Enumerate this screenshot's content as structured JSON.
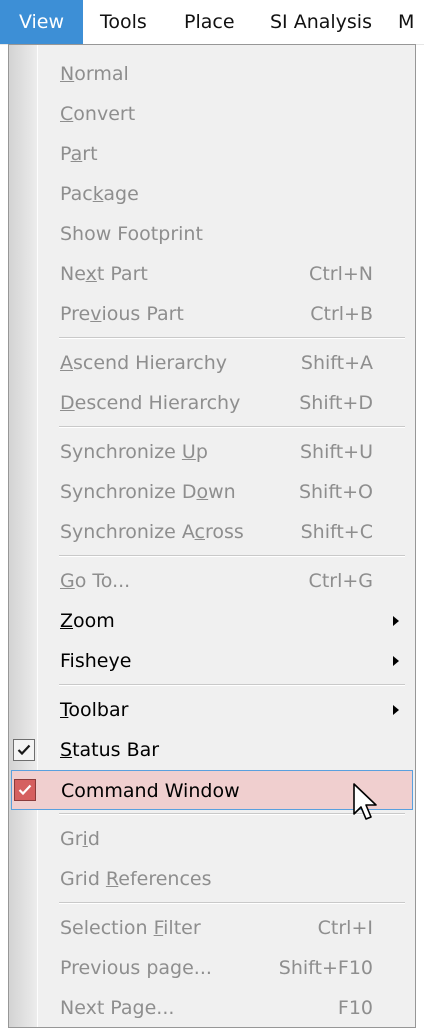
{
  "menubar": {
    "items": [
      {
        "label": "View",
        "active": true
      },
      {
        "label": "Tools"
      },
      {
        "label": "Place"
      },
      {
        "label": "SI Analysis"
      },
      {
        "label": "M"
      }
    ]
  },
  "menu": {
    "items": [
      {
        "pre": "",
        "u": "N",
        "post": "ormal",
        "shortcut": "",
        "state": "disabled"
      },
      {
        "pre": "",
        "u": "C",
        "post": "onvert",
        "shortcut": "",
        "state": "disabled"
      },
      {
        "pre": "P",
        "u": "a",
        "post": "rt",
        "shortcut": "",
        "state": "disabled"
      },
      {
        "pre": "Pac",
        "u": "k",
        "post": "age",
        "shortcut": "",
        "state": "disabled"
      },
      {
        "pre": "Show Footprint",
        "u": "",
        "post": "",
        "shortcut": "",
        "state": "disabled"
      },
      {
        "pre": "Ne",
        "u": "x",
        "post": "t Part",
        "shortcut": "Ctrl+N",
        "state": "disabled"
      },
      {
        "pre": "Pre",
        "u": "v",
        "post": "ious Part",
        "shortcut": "Ctrl+B",
        "state": "disabled"
      },
      {
        "pre": "",
        "u": "A",
        "post": "scend Hierarchy",
        "shortcut": "Shift+A",
        "state": "disabled"
      },
      {
        "pre": "",
        "u": "D",
        "post": "escend Hierarchy",
        "shortcut": "Shift+D",
        "state": "disabled"
      },
      {
        "pre": "Synchronize ",
        "u": "U",
        "post": "p",
        "shortcut": "Shift+U",
        "state": "disabled"
      },
      {
        "pre": "Synchronize D",
        "u": "o",
        "post": "wn",
        "shortcut": "Shift+O",
        "state": "disabled"
      },
      {
        "pre": "Synchronize A",
        "u": "c",
        "post": "ross",
        "shortcut": "Shift+C",
        "state": "disabled"
      },
      {
        "pre": "",
        "u": "G",
        "post": "o To...",
        "shortcut": "Ctrl+G",
        "state": "disabled"
      },
      {
        "pre": "",
        "u": "Z",
        "post": "oom",
        "shortcut": "",
        "state": "enabled",
        "submenu": true
      },
      {
        "pre": "Fisheye",
        "u": "",
        "post": "",
        "shortcut": "",
        "state": "enabled",
        "submenu": true
      },
      {
        "pre": "",
        "u": "T",
        "post": "oolbar",
        "shortcut": "",
        "state": "enabled",
        "submenu": true
      },
      {
        "pre": "",
        "u": "S",
        "post": "tatus Bar",
        "shortcut": "",
        "state": "enabled",
        "checked": true
      },
      {
        "pre": "Command Window",
        "u": "",
        "post": "",
        "shortcut": "",
        "state": "enabled",
        "checked": true,
        "highlighted": true
      },
      {
        "pre": "Gr",
        "u": "i",
        "post": "d",
        "shortcut": "",
        "state": "disabled"
      },
      {
        "pre": "Grid ",
        "u": "R",
        "post": "eferences",
        "shortcut": "",
        "state": "disabled"
      },
      {
        "pre": "Selection ",
        "u": "F",
        "post": "ilter",
        "shortcut": "Ctrl+I",
        "state": "disabled"
      },
      {
        "pre": "Previous page...",
        "u": "",
        "post": "",
        "shortcut": "Shift+F10",
        "state": "disabled"
      },
      {
        "pre": "Next Page...",
        "u": "",
        "post": "",
        "shortcut": "F10",
        "state": "disabled"
      }
    ]
  },
  "colors": {
    "menubar_active": "#3d8fd6",
    "highlight_fill": "#f0cfcf",
    "highlight_border": "#5aa0de",
    "checkbox_highlight": "#d56060",
    "disabled_text": "#8e8e8e"
  },
  "cursor": {
    "icon": "arrow-cursor-icon"
  }
}
